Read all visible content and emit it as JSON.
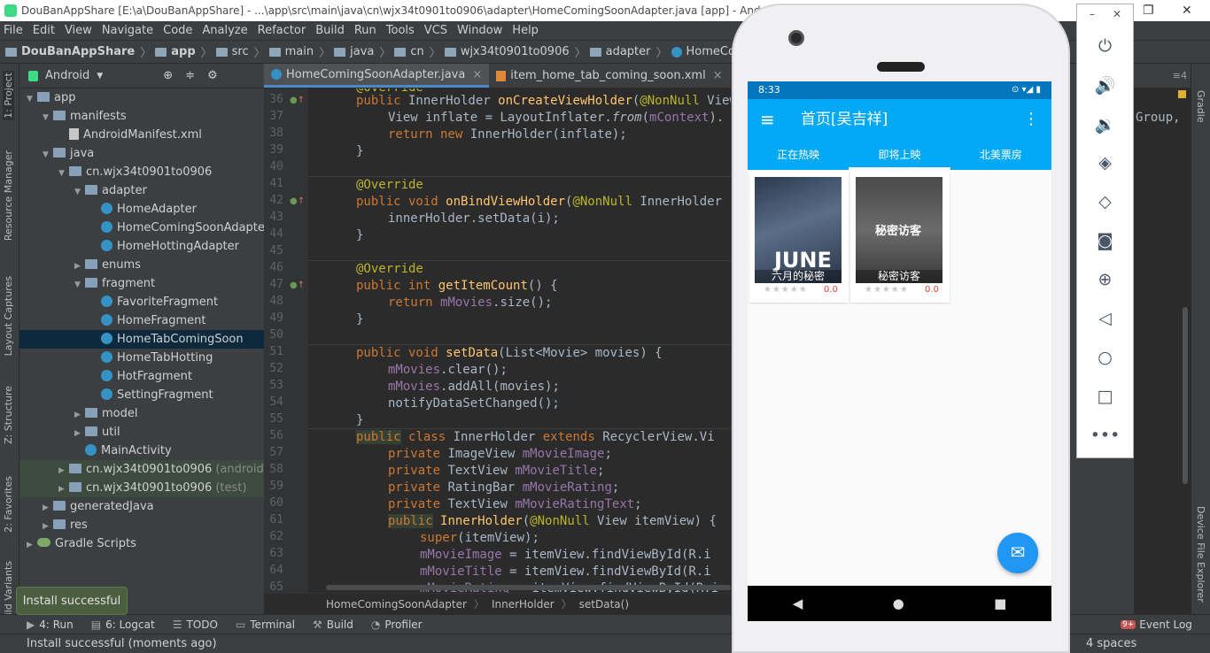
{
  "window_title": "DouBanAppShare [E:\\a\\DouBanAppShare] - ...\\app\\src\\main\\java\\cn\\wjx34t0901to0906\\adapter\\HomeComingSoonAdapter.java [app] - Android",
  "menu": [
    "File",
    "Edit",
    "View",
    "Navigate",
    "Code",
    "Analyze",
    "Refactor",
    "Build",
    "Run",
    "Tools",
    "VCS",
    "Window",
    "Help"
  ],
  "breadcrumbs": [
    "DouBanAppShare",
    "app",
    "src",
    "main",
    "java",
    "cn",
    "wjx34t0901to0906",
    "adapter",
    "HomeComingSoonAdapter"
  ],
  "left_tools": [
    "1: Project",
    "Resource Manager",
    "Layout Captures",
    "Z: Structure",
    "2: Favorites",
    "ild Variants"
  ],
  "project_view": "Android",
  "tree": [
    {
      "label": "app",
      "depth": 0,
      "kind": "folder",
      "expanded": true
    },
    {
      "label": "manifests",
      "depth": 1,
      "kind": "folder",
      "expanded": true
    },
    {
      "label": "AndroidManifest.xml",
      "depth": 2,
      "kind": "file"
    },
    {
      "label": "java",
      "depth": 1,
      "kind": "folder",
      "expanded": true
    },
    {
      "label": "cn.wjx34t0901to0906",
      "depth": 2,
      "kind": "folder",
      "expanded": true
    },
    {
      "label": "adapter",
      "depth": 3,
      "kind": "folder",
      "expanded": true
    },
    {
      "label": "HomeAdapter",
      "depth": 4,
      "kind": "class"
    },
    {
      "label": "HomeComingSoonAdapter",
      "depth": 4,
      "kind": "class"
    },
    {
      "label": "HomeHottingAdapter",
      "depth": 4,
      "kind": "class"
    },
    {
      "label": "enums",
      "depth": 3,
      "kind": "folder",
      "expanded": false
    },
    {
      "label": "fragment",
      "depth": 3,
      "kind": "folder",
      "expanded": true
    },
    {
      "label": "FavoriteFragment",
      "depth": 4,
      "kind": "class"
    },
    {
      "label": "HomeFragment",
      "depth": 4,
      "kind": "class"
    },
    {
      "label": "HomeTabComingSoon",
      "depth": 4,
      "kind": "class",
      "selected": true
    },
    {
      "label": "HomeTabHotting",
      "depth": 4,
      "kind": "class"
    },
    {
      "label": "HotFragment",
      "depth": 4,
      "kind": "class"
    },
    {
      "label": "SettingFragment",
      "depth": 4,
      "kind": "class"
    },
    {
      "label": "model",
      "depth": 3,
      "kind": "folder",
      "expanded": false
    },
    {
      "label": "util",
      "depth": 3,
      "kind": "folder",
      "expanded": false
    },
    {
      "label": "MainActivity",
      "depth": 3,
      "kind": "class"
    },
    {
      "label": "cn.wjx34t0901to0906",
      "suffix": "(androidTest)",
      "depth": 2,
      "kind": "folder",
      "expanded": false,
      "green": true
    },
    {
      "label": "cn.wjx34t0901to0906",
      "suffix": "(test)",
      "depth": 2,
      "kind": "folder",
      "expanded": false,
      "green": true
    },
    {
      "label": "generatedJava",
      "depth": 1,
      "kind": "folder",
      "expanded": false
    },
    {
      "label": "res",
      "depth": 1,
      "kind": "folder",
      "expanded": false
    },
    {
      "label": "Gradle Scripts",
      "depth": 0,
      "kind": "gradle",
      "expanded": false
    }
  ],
  "editor_tabs": [
    {
      "label": "HomeComingSoonAdapter.java",
      "active": true
    },
    {
      "label": "item_home_tab_coming_soon.xml",
      "active": false
    }
  ],
  "line_numbers": [
    "36",
    "37",
    "38",
    "39",
    "40",
    "41",
    "42",
    "43",
    "44",
    "45",
    "46",
    "47",
    "48",
    "49",
    "50",
    "51",
    "52",
    "53",
    "54",
    "55",
    "56",
    "57",
    "58",
    "59",
    "60",
    "61",
    "62",
    "63",
    "64",
    "65"
  ],
  "code_breadcrumb": [
    "HomeComingSoonAdapter",
    "InnerHolder",
    "setData()"
  ],
  "bottom_tools": [
    "4: Run",
    "6: Logcat",
    "TODO",
    "Terminal",
    "Build",
    "Profiler"
  ],
  "event_log": {
    "label": "Event Log",
    "badge": "9+"
  },
  "toast": "Install successful",
  "status_text": "Install successful (moments ago)",
  "indent_setting": "4 spaces",
  "right_tools": [
    "Gradle",
    "Device File Explorer"
  ],
  "right_code_fragment": "Group,",
  "phone": {
    "time": "8:33",
    "app_title": "首页[吴吉祥]",
    "tabs": [
      "正在热映",
      "即将上映",
      "北美票房"
    ],
    "active_tab": 1,
    "movies": [
      {
        "title": "六月的秘密",
        "poster_text": "JUNE",
        "rating": "0.0"
      },
      {
        "title": "秘密访客",
        "poster_text": "秘密访客",
        "rating": "0.0"
      }
    ],
    "stars": "★★★★★"
  },
  "emulator_controls": [
    "power-icon",
    "volume-up-icon",
    "volume-down-icon",
    "rotate-left-icon",
    "rotate-right-icon",
    "camera-icon",
    "zoom-icon",
    "back-icon",
    "home-icon",
    "overview-icon",
    "more-icon"
  ]
}
